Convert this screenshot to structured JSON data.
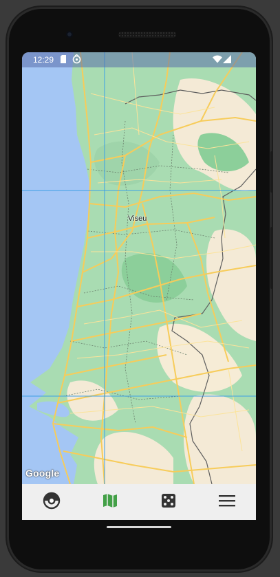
{
  "status_bar": {
    "time": "12:29",
    "left_icons": [
      "sim-card-icon",
      "app-notification-icon"
    ],
    "right_icons": [
      "wifi-icon",
      "cellular-signal-icon"
    ]
  },
  "map": {
    "place_label": "Viseu",
    "attribution": "Google",
    "colors": {
      "water": "#a4c6f4",
      "land": "#a9dcb2",
      "road": "#f7cc5a",
      "grid_line": "#3b9fe5"
    }
  },
  "bottom_nav": {
    "items": [
      {
        "icon": "pokeball-icon",
        "active": false
      },
      {
        "icon": "map-icon",
        "active": true
      },
      {
        "icon": "dice-icon",
        "active": false
      },
      {
        "icon": "menu-icon",
        "active": false
      }
    ],
    "active_color": "#43a047"
  }
}
